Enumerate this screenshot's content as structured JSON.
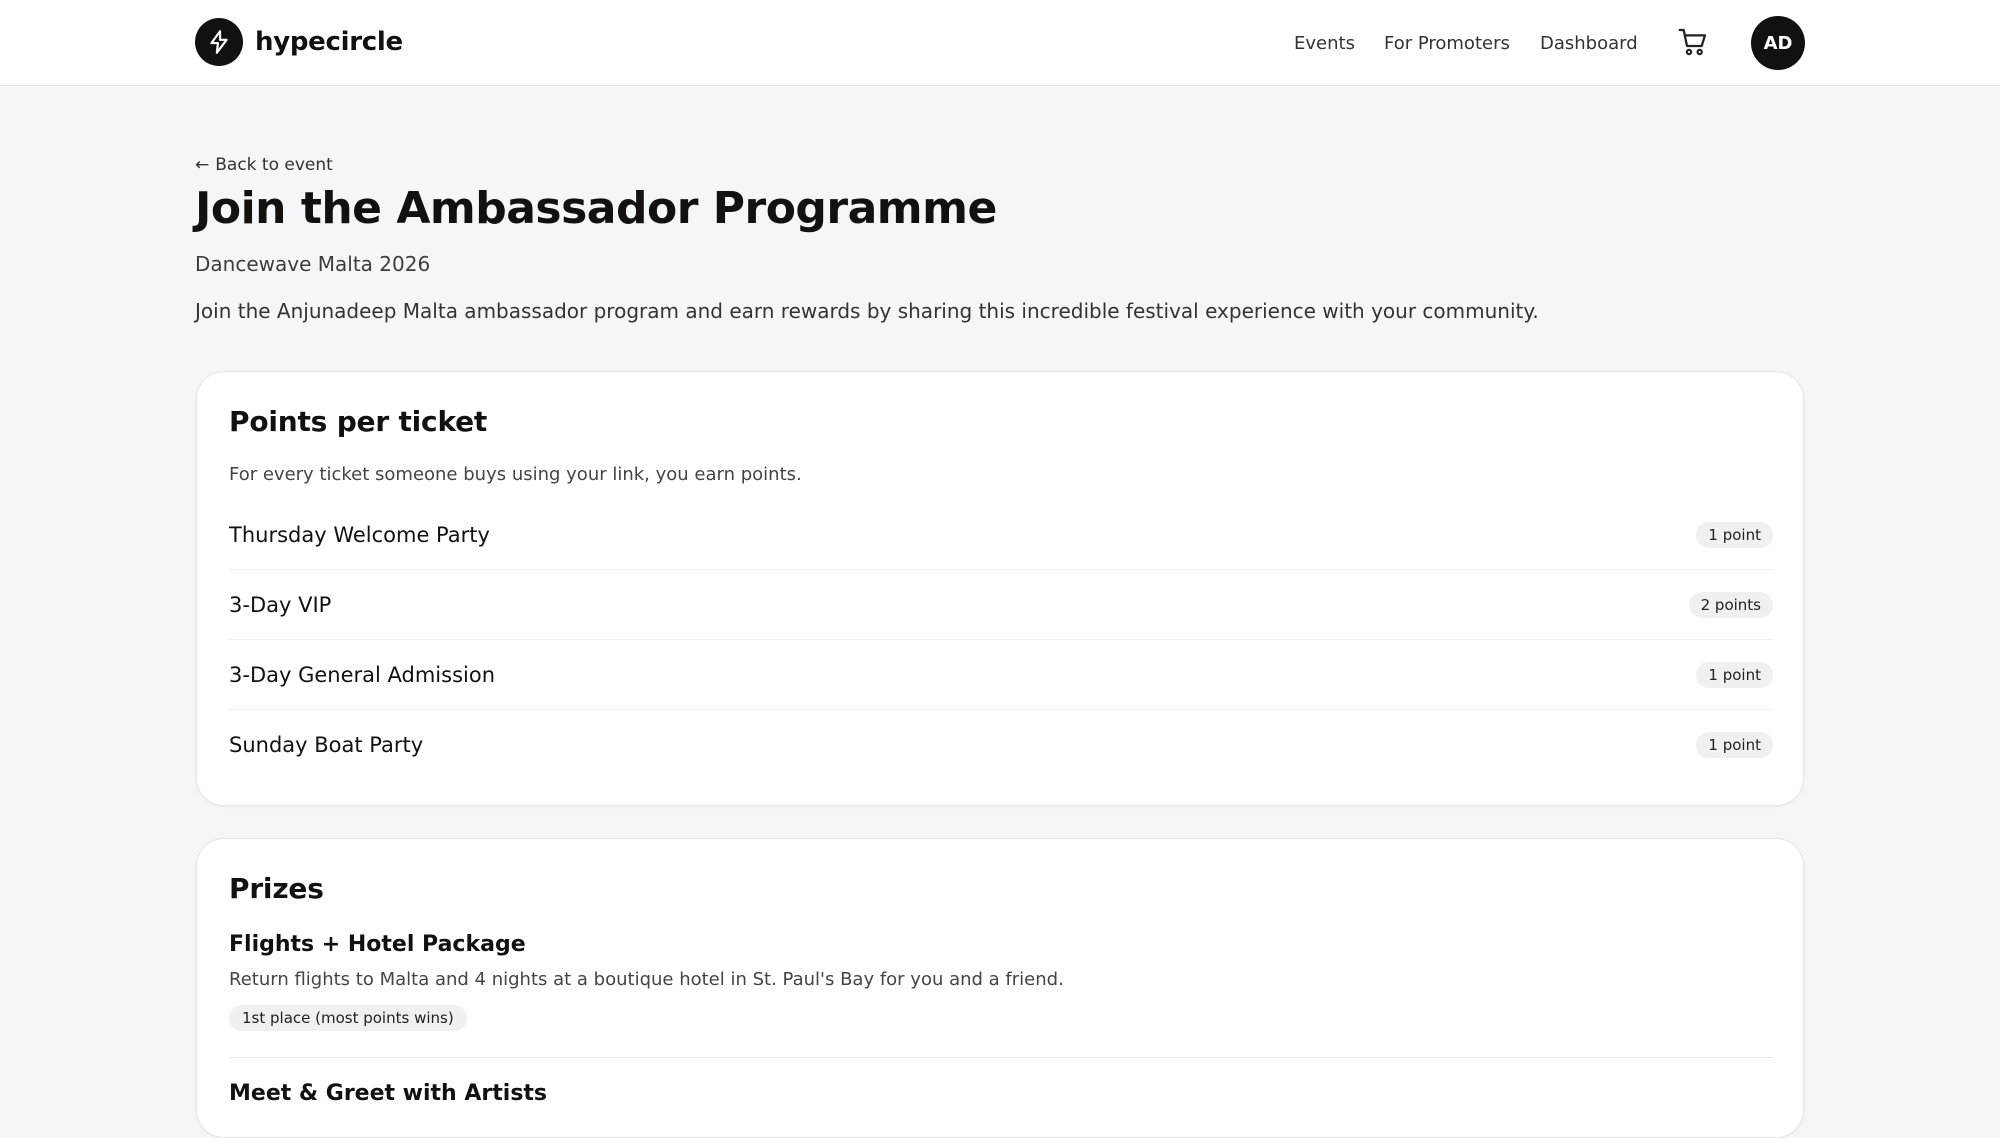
{
  "header": {
    "logo_text": "hypecircle",
    "nav": [
      "Events",
      "For Promoters",
      "Dashboard"
    ],
    "avatar_initials": "AD",
    "icons": {
      "logo": "bolt-icon",
      "cart": "cart-icon"
    }
  },
  "intro": {
    "back_label": "Back to event",
    "title": "Join the Ambassador Programme",
    "subtitle": "Dancewave Malta 2026",
    "description": "Join the Anjunadeep Malta ambassador program and earn rewards by sharing this incredible festival experience with your community."
  },
  "points": {
    "title": "Points per ticket",
    "description": "For every ticket someone buys using your link, you earn points.",
    "tickets": [
      {
        "name": "Thursday Welcome Party",
        "points": "1 point"
      },
      {
        "name": "3-Day VIP",
        "points": "2 points"
      },
      {
        "name": "3-Day General Admission",
        "points": "1 point"
      },
      {
        "name": "Sunday Boat Party",
        "points": "1 point"
      }
    ]
  },
  "prizes": {
    "title": "Prizes",
    "items": [
      {
        "name": "Flights + Hotel Package",
        "description": "Return flights to Malta and 4 nights at a boutique hotel in St. Paul's Bay for you and a friend.",
        "badge": "1st place (most points wins)"
      },
      {
        "name": "Meet & Greet with Artists"
      }
    ]
  },
  "colors": {
    "background": "#f5f6f7",
    "card": "#ffffff",
    "text": "#111111",
    "badge": "#eff0f2",
    "accent": "#111111"
  }
}
